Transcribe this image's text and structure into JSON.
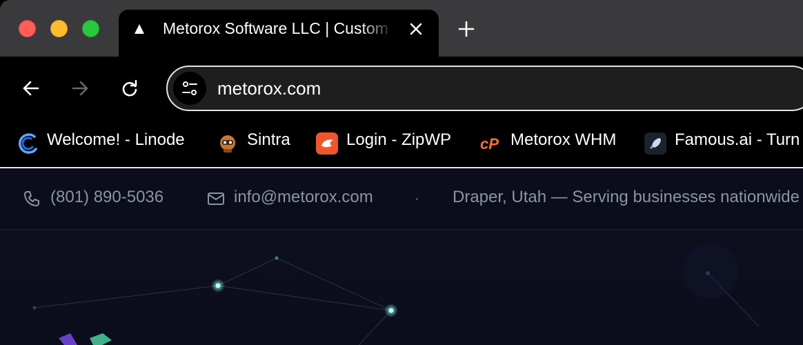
{
  "browser": {
    "tab": {
      "title": "Metorox Software LLC | Custom Software Development",
      "favicon": "triangle-icon"
    },
    "url": "metorox.com",
    "bookmarks": [
      {
        "label": "Welcome! - Linode",
        "icon": "linode-icon"
      },
      {
        "label": "Sintra",
        "icon": "sintra-icon"
      },
      {
        "label": "Login - ZipWP",
        "icon": "zipwp-icon"
      },
      {
        "label": "Metorox WHM",
        "icon": "cpanel-icon"
      },
      {
        "label": "Famous.ai - Turn",
        "icon": "famous-rocket-icon"
      }
    ]
  },
  "site": {
    "topbar": {
      "phone": "(801) 890-5036",
      "email": "info@metorox.com",
      "location": "Draper, Utah — Serving businesses nationwide"
    }
  }
}
